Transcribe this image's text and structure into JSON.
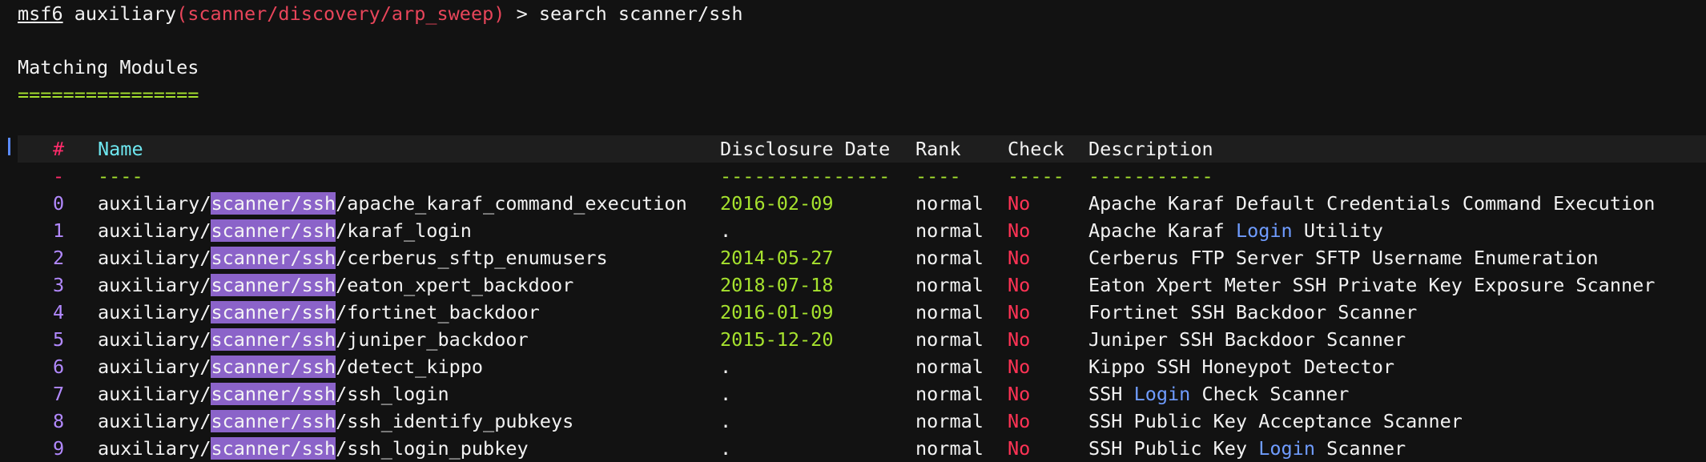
{
  "prompt": {
    "msf": "msf6",
    "type": "auxiliary",
    "module": "scanner/discovery/arp_sweep",
    "symbol": ">",
    "command": "search scanner/ssh"
  },
  "section": {
    "title": "Matching Modules",
    "underline": "================"
  },
  "columns": {
    "num": "#",
    "name": "Name",
    "date": "Disclosure Date",
    "rank": "Rank",
    "check": "Check",
    "desc": "Description"
  },
  "dividers": {
    "num": "-",
    "name": "----",
    "date": "---------------",
    "rank": "----",
    "check": "-----",
    "desc": "-----------"
  },
  "rows": [
    {
      "num": "0",
      "prefix": "auxiliary/",
      "match": "scanner/ssh",
      "suffix": "/apache_karaf_command_execution",
      "date": "2016-02-09",
      "rank": "normal",
      "check": "No",
      "desc_pre": "Apache Karaf Default Credentials Command Execution",
      "desc_hl": "",
      "desc_post": ""
    },
    {
      "num": "1",
      "prefix": "auxiliary/",
      "match": "scanner/ssh",
      "suffix": "/karaf_login",
      "date": ".",
      "rank": "normal",
      "check": "No",
      "desc_pre": "Apache Karaf ",
      "desc_hl": "Login",
      "desc_post": " Utility"
    },
    {
      "num": "2",
      "prefix": "auxiliary/",
      "match": "scanner/ssh",
      "suffix": "/cerberus_sftp_enumusers",
      "date": "2014-05-27",
      "rank": "normal",
      "check": "No",
      "desc_pre": "Cerberus FTP Server SFTP Username Enumeration",
      "desc_hl": "",
      "desc_post": ""
    },
    {
      "num": "3",
      "prefix": "auxiliary/",
      "match": "scanner/ssh",
      "suffix": "/eaton_xpert_backdoor",
      "date": "2018-07-18",
      "rank": "normal",
      "check": "No",
      "desc_pre": "Eaton Xpert Meter SSH Private Key Exposure Scanner",
      "desc_hl": "",
      "desc_post": ""
    },
    {
      "num": "4",
      "prefix": "auxiliary/",
      "match": "scanner/ssh",
      "suffix": "/fortinet_backdoor",
      "date": "2016-01-09",
      "rank": "normal",
      "check": "No",
      "desc_pre": "Fortinet SSH Backdoor Scanner",
      "desc_hl": "",
      "desc_post": ""
    },
    {
      "num": "5",
      "prefix": "auxiliary/",
      "match": "scanner/ssh",
      "suffix": "/juniper_backdoor",
      "date": "2015-12-20",
      "rank": "normal",
      "check": "No",
      "desc_pre": "Juniper SSH Backdoor Scanner",
      "desc_hl": "",
      "desc_post": ""
    },
    {
      "num": "6",
      "prefix": "auxiliary/",
      "match": "scanner/ssh",
      "suffix": "/detect_kippo",
      "date": ".",
      "rank": "normal",
      "check": "No",
      "desc_pre": "Kippo SSH Honeypot Detector",
      "desc_hl": "",
      "desc_post": ""
    },
    {
      "num": "7",
      "prefix": "auxiliary/",
      "match": "scanner/ssh",
      "suffix": "/ssh_login",
      "date": ".",
      "rank": "normal",
      "check": "No",
      "desc_pre": "SSH ",
      "desc_hl": "Login",
      "desc_post": " Check Scanner"
    },
    {
      "num": "8",
      "prefix": "auxiliary/",
      "match": "scanner/ssh",
      "suffix": "/ssh_identify_pubkeys",
      "date": ".",
      "rank": "normal",
      "check": "No",
      "desc_pre": "SSH Public Key Acceptance Scanner",
      "desc_hl": "",
      "desc_post": ""
    },
    {
      "num": "9",
      "prefix": "auxiliary/",
      "match": "scanner/ssh",
      "suffix": "/ssh_login_pubkey",
      "date": ".",
      "rank": "normal",
      "check": "No",
      "desc_pre": "SSH Public Key ",
      "desc_hl": "Login",
      "desc_post": " Scanner"
    }
  ]
}
